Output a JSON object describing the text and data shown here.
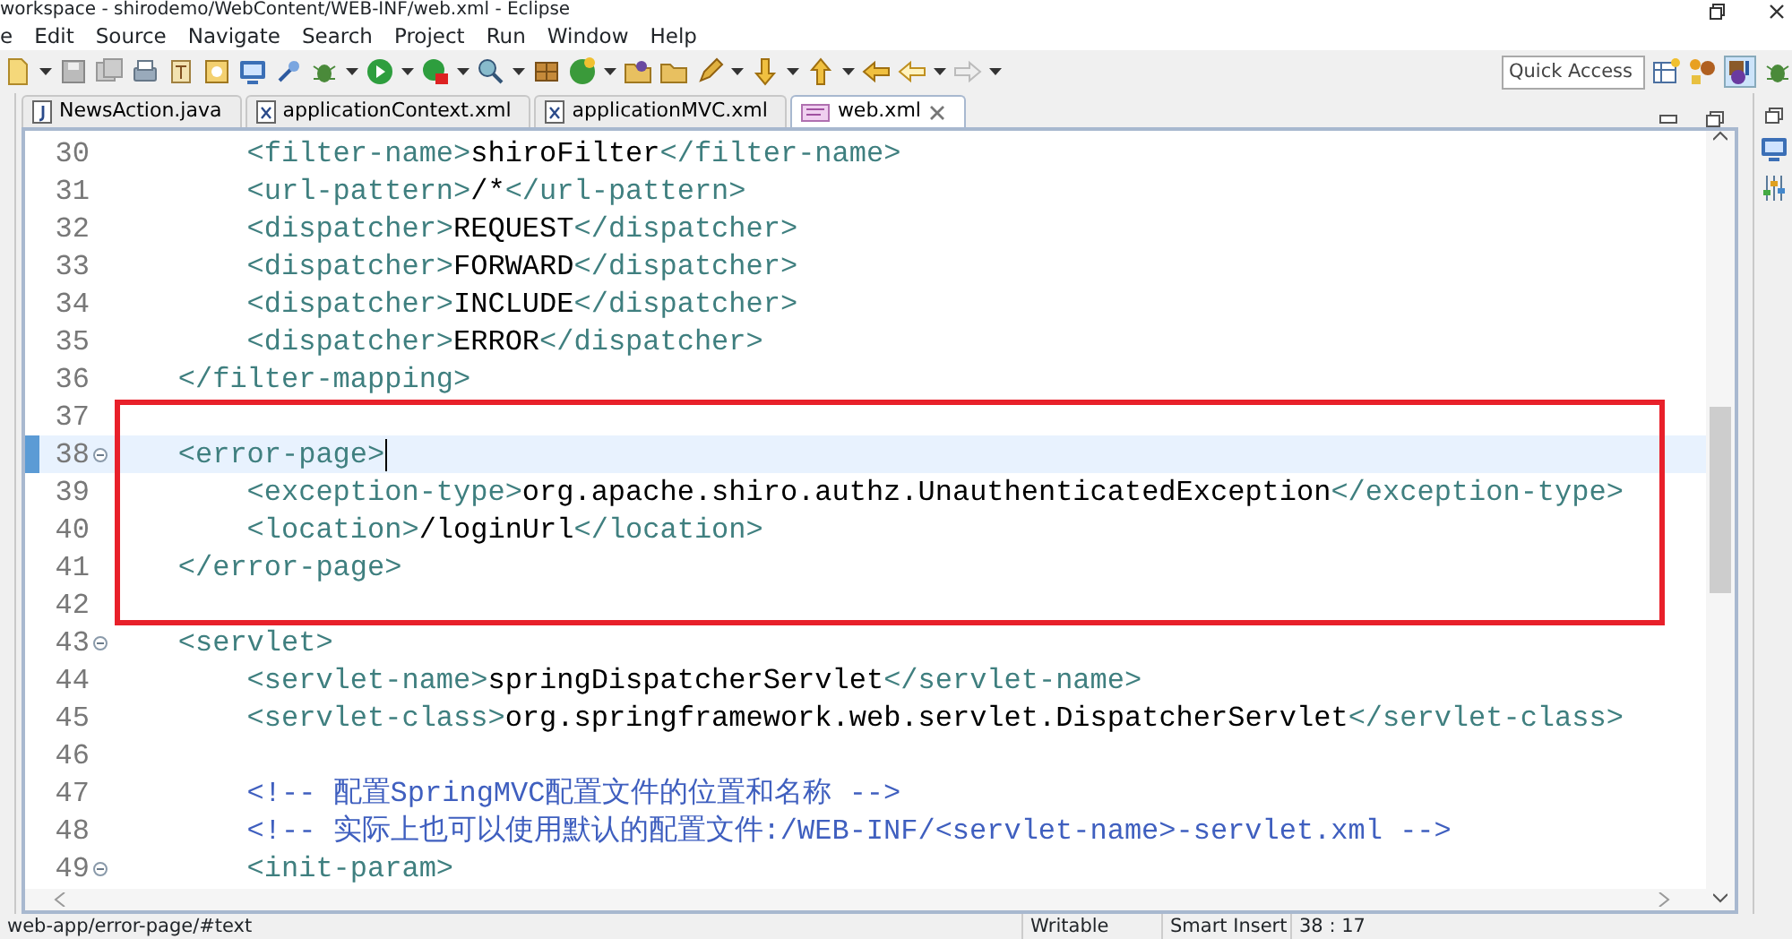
{
  "window": {
    "title": "workspace - shirodemo/WebContent/WEB-INF/web.xml - Eclipse"
  },
  "menu": [
    "e",
    "Edit",
    "Source",
    "Navigate",
    "Search",
    "Project",
    "Run",
    "Window",
    "Help"
  ],
  "toolbar": {
    "quick_access": {
      "placeholder": "Quick Access"
    }
  },
  "tabs": [
    {
      "label": "NewsAction.java",
      "kind": "java",
      "selected": false
    },
    {
      "label": "applicationContext.xml",
      "kind": "xml",
      "selected": false
    },
    {
      "label": "applicationMVC.xml",
      "kind": "xml",
      "selected": false
    },
    {
      "label": "web.xml",
      "kind": "web",
      "selected": true
    }
  ],
  "editor": {
    "blocks": [
      {
        "boxed": false,
        "lines": [
          {
            "number": "30",
            "current": false,
            "foldable": false,
            "tokens": [
              {
                "kind": "tag",
                "text": "<filter-name>"
              },
              {
                "kind": "text",
                "text": "shiroFilter"
              },
              {
                "kind": "tag",
                "text": "</filter-name>"
              }
            ]
          },
          {
            "number": "31",
            "current": false,
            "foldable": false,
            "tokens": [
              {
                "kind": "tag",
                "text": "<url-pattern>"
              },
              {
                "kind": "text",
                "text": "/*"
              },
              {
                "kind": "tag",
                "text": "</url-pattern>"
              }
            ]
          },
          {
            "number": "32",
            "current": false,
            "foldable": false,
            "tokens": [
              {
                "kind": "tag",
                "text": "<dispatcher>"
              },
              {
                "kind": "text",
                "text": "REQUEST"
              },
              {
                "kind": "tag",
                "text": "</dispatcher>"
              }
            ]
          },
          {
            "number": "33",
            "current": false,
            "foldable": false,
            "tokens": [
              {
                "kind": "tag",
                "text": "<dispatcher>"
              },
              {
                "kind": "text",
                "text": "FORWARD"
              },
              {
                "kind": "tag",
                "text": "</dispatcher>"
              }
            ]
          },
          {
            "number": "34",
            "current": false,
            "foldable": false,
            "tokens": [
              {
                "kind": "tag",
                "text": "<dispatcher>"
              },
              {
                "kind": "text",
                "text": "INCLUDE"
              },
              {
                "kind": "tag",
                "text": "</dispatcher>"
              }
            ]
          },
          {
            "number": "35",
            "current": false,
            "foldable": false,
            "tokens": [
              {
                "kind": "tag",
                "text": "<dispatcher>"
              },
              {
                "kind": "text",
                "text": "ERROR"
              },
              {
                "kind": "tag",
                "text": "</dispatcher>"
              }
            ]
          },
          {
            "number": "36",
            "current": false,
            "foldable": false,
            "tokens": [
              {
                "kind": "close_tag",
                "text": "</filter-mapping>"
              }
            ]
          }
        ]
      },
      {
        "boxed": true,
        "lines": [
          {
            "number": "37",
            "current": false,
            "foldable": false
          },
          {
            "number": "38",
            "current": true,
            "foldable": true,
            "tokens": [
              {
                "kind": "open_tag",
                "text": "<error-page>"
              }
            ]
          },
          {
            "number": "39",
            "current": false,
            "foldable": false,
            "tokens": [
              {
                "kind": "tag",
                "text": "<exception-type>"
              },
              {
                "kind": "text",
                "text": "org.apache.shiro.authz.UnauthenticatedException"
              },
              {
                "kind": "tag",
                "text": "</exception-type>"
              }
            ]
          },
          {
            "number": "40",
            "current": false,
            "foldable": false,
            "tokens": [
              {
                "kind": "tag",
                "text": "<location>"
              },
              {
                "kind": "text",
                "text": "/loginUrl"
              },
              {
                "kind": "tag",
                "text": "</location>"
              }
            ]
          },
          {
            "number": "41",
            "current": false,
            "foldable": false,
            "tokens": [
              {
                "kind": "close_tag",
                "text": "</error-page>"
              }
            ]
          },
          {
            "number": "42",
            "current": false,
            "foldable": false
          }
        ]
      },
      {
        "boxed": false,
        "lines": [
          {
            "number": "43",
            "current": false,
            "foldable": true,
            "tokens": [
              {
                "kind": "open_tag",
                "text": "<servlet>"
              }
            ]
          },
          {
            "number": "44",
            "current": false,
            "foldable": false,
            "tokens": [
              {
                "kind": "tag",
                "text": "<servlet-name>"
              },
              {
                "kind": "text",
                "text": "springDispatcherServlet"
              },
              {
                "kind": "tag",
                "text": "</servlet-name>"
              }
            ]
          },
          {
            "number": "45",
            "current": false,
            "foldable": false,
            "tokens": [
              {
                "kind": "tag",
                "text": "<servlet-class>"
              },
              {
                "kind": "text",
                "text": "org.springframework.web.servlet.DispatcherServlet"
              },
              {
                "kind": "tag",
                "text": "</servlet-class>"
              }
            ]
          },
          {
            "number": "46",
            "current": false,
            "foldable": false
          },
          {
            "number": "47",
            "current": false,
            "foldable": false,
            "tokens": [
              {
                "kind": "comment",
                "text": "<!-- 配置SpringMVC配置文件的位置和名称 -->"
              }
            ]
          },
          {
            "number": "48",
            "current": false,
            "foldable": false,
            "tokens": [
              {
                "kind": "comment",
                "text": "<!-- 实际上也可以使用默认的配置文件:/WEB-INF/<servlet-name>-servlet.xml -->"
              }
            ]
          },
          {
            "number": "49",
            "current": false,
            "foldable": true,
            "tokens": [
              {
                "kind": "open_tag",
                "text": "<init-param>"
              }
            ]
          }
        ]
      }
    ]
  },
  "status_bar": {
    "path": "web-app/error-page/#text",
    "mode": "Writable",
    "insert": "Smart Insert",
    "position": "38 : 17"
  }
}
